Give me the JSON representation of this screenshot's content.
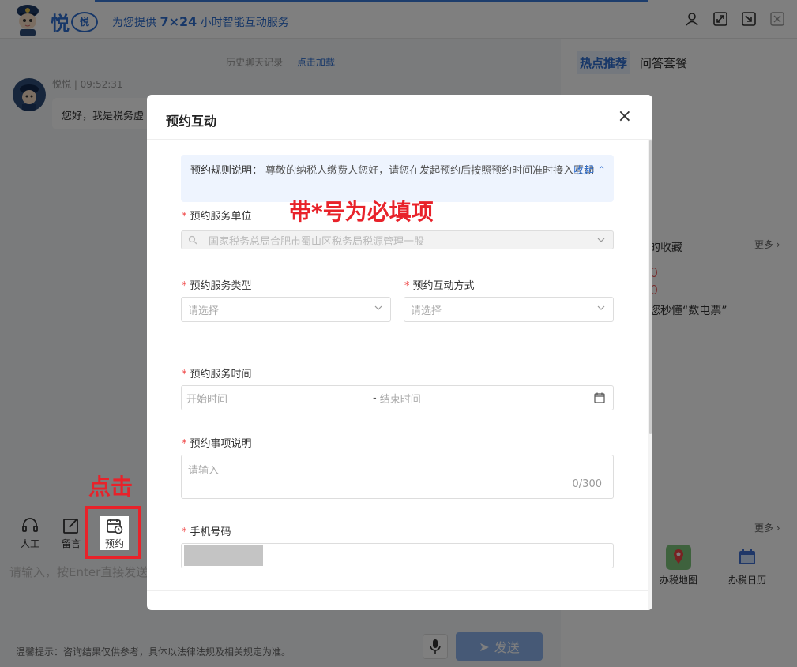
{
  "header": {
    "brand_name": "悦",
    "brand_badge": "悦",
    "slogan_prefix": "为您提供",
    "slogan_highlight": "7×24",
    "slogan_suffix": "小时智能互动服务",
    "icons": [
      "user-icon",
      "expand-icon",
      "export-icon",
      "close-icon"
    ]
  },
  "chat": {
    "history_label": "历史聊天记录",
    "history_link": "点击加载",
    "bot_meta": "悦悦 | 09:52:31",
    "bot_message": "您好，我是税务虚",
    "tools": [
      {
        "label": "人工",
        "icon": "headset-icon"
      },
      {
        "label": "留言",
        "icon": "edit-icon"
      },
      {
        "label": "预约",
        "icon": "calendar-clock-icon"
      }
    ],
    "input_placeholder": "请输入，按Enter直接发送",
    "tip": "温馨提示：咨询结果仅供参考，具体以法律法规及相关规定为准。",
    "send_label": "发送"
  },
  "right_panel": {
    "tabs": [
      "热点推荐",
      "问答套餐"
    ],
    "fav_title": "的收藏",
    "more": "更多",
    "fav_item": "您秒懂“数电票”",
    "more2": "更多",
    "apps": [
      {
        "label": "办税地图",
        "icon": "map-pin-icon"
      },
      {
        "label": "办税日历",
        "icon": "calendar-icon"
      }
    ]
  },
  "dialog": {
    "title": "预约互动",
    "notice_label": "预约规则说明：",
    "notice_text": "尊敬的纳税人缴费人您好，请您在发起预约后按照预约时间准时接入互动",
    "collapse_label": "收起",
    "required_mark": "*",
    "fields": {
      "unit": {
        "label": "预约服务单位",
        "value": "国家税务总局合肥市蜀山区税务局税源管理一股"
      },
      "type": {
        "label": "预约服务类型",
        "placeholder": "请选择"
      },
      "mode": {
        "label": "预约互动方式",
        "placeholder": "请选择"
      },
      "time": {
        "label": "预约服务时间",
        "start_placeholder": "开始时间",
        "separator": "-",
        "end_placeholder": "结束时间"
      },
      "desc": {
        "label": "预约事项说明",
        "placeholder": "请输入",
        "counter": "0/300"
      },
      "phone": {
        "label": "手机号码"
      }
    }
  },
  "annotations": {
    "required_note": "带*号为必填项",
    "click_note": "点击"
  },
  "colors": {
    "accent": "#2f6fd1",
    "annotation_red": "#e8222a",
    "required_red": "#f04a4a"
  }
}
